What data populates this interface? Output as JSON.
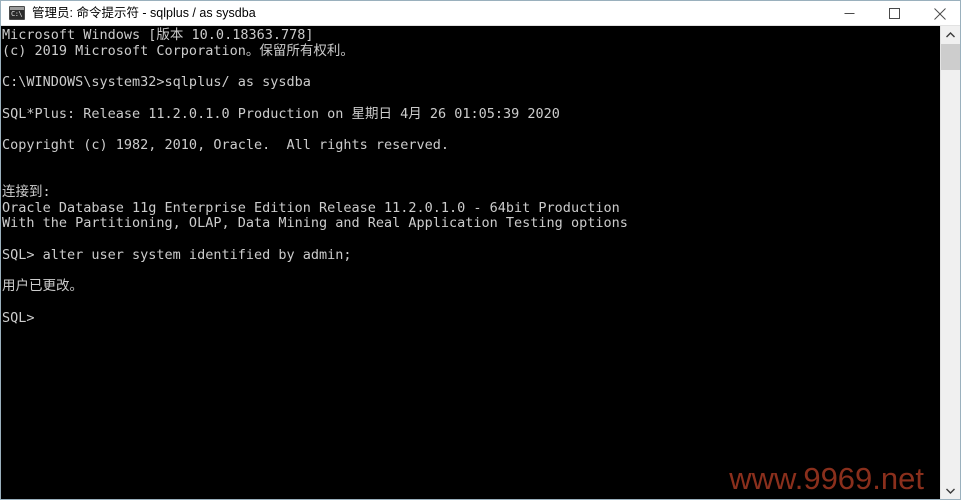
{
  "window": {
    "title": "管理员: 命令提示符 - sqlplus / as sysdba",
    "icon_name": "cmd-prompt-icon",
    "icon_glyph": "C:\\",
    "background_color": "#000000",
    "titlebar_color": "#ffffff",
    "controls": {
      "minimize_label": "最小化",
      "maximize_label": "最大化",
      "close_label": "关闭"
    }
  },
  "console": {
    "foreground_color": "#cccccc",
    "background_color": "#000000",
    "lines": [
      "Microsoft Windows [版本 10.0.18363.778]",
      "(c) 2019 Microsoft Corporation。保留所有权利。",
      "",
      "C:\\WINDOWS\\system32>sqlplus/ as sysdba",
      "",
      "SQL*Plus: Release 11.2.0.1.0 Production on 星期日 4月 26 01:05:39 2020",
      "",
      "Copyright (c) 1982, 2010, Oracle.  All rights reserved.",
      "",
      "",
      "连接到:",
      "Oracle Database 11g Enterprise Edition Release 11.2.0.1.0 - 64bit Production",
      "With the Partitioning, OLAP, Data Mining and Real Application Testing options",
      "",
      "SQL> alter user system identified by admin;",
      "",
      "用户已更改。",
      "",
      "SQL>"
    ]
  },
  "watermark": {
    "text": "www.9969.net",
    "color": "#8a2f1c"
  },
  "scrollbar": {
    "up_arrow": "scroll-up-icon",
    "down_arrow": "scroll-down-icon",
    "track_color": "#f0f0f0",
    "thumb_color": "#cdcdcd"
  }
}
